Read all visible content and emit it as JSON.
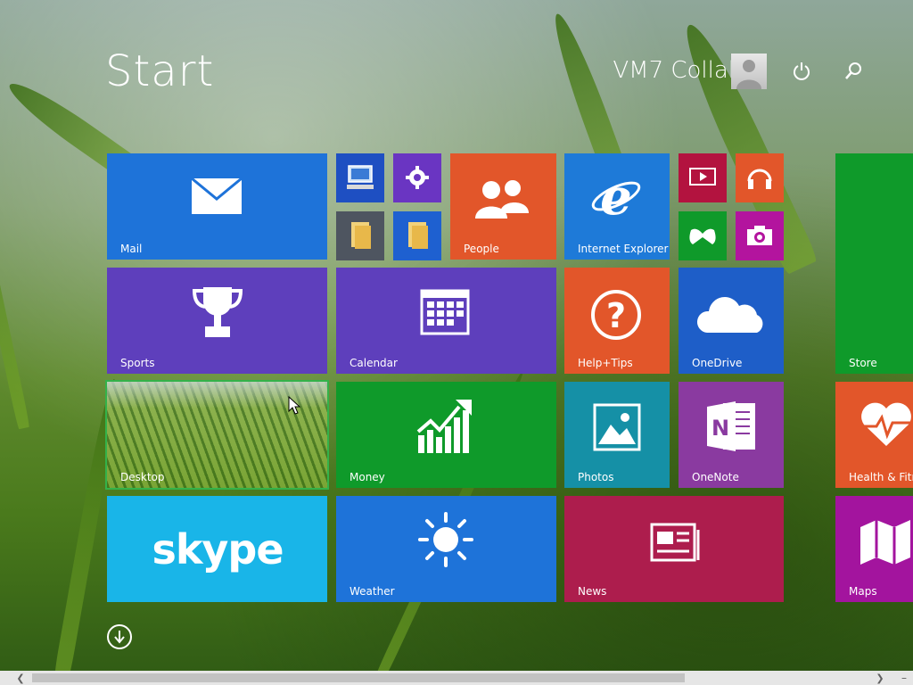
{
  "header": {
    "title": "Start",
    "user_name": "VM7 Collaber"
  },
  "icons": {
    "power": "power-icon",
    "search": "search-icon",
    "down": "arrow-down-icon"
  },
  "tiles": {
    "mail": "Mail",
    "people": "People",
    "internet_explorer": "Internet Explorer",
    "sports": "Sports",
    "calendar": "Calendar",
    "help_tips": "Help+Tips",
    "onedrive": "OneDrive",
    "store": "Store",
    "desktop": "Desktop",
    "money": "Money",
    "photos": "Photos",
    "onenote": "OneNote",
    "health": "Health & Fitne",
    "skype": "skype",
    "weather": "Weather",
    "news": "News",
    "maps": "Maps"
  },
  "colors": {
    "mail": "#1e73d9",
    "people": "#e2562a",
    "ie": "#1e7ad8",
    "sports": "#5e3fbc",
    "calendar": "#5e3fbc",
    "help": "#e2562a",
    "onedrive": "#1e5ec8",
    "store": "#0f9a2a",
    "money": "#0f9a2a",
    "photos": "#1590a6",
    "onenote": "#8a3aa0",
    "health": "#e2562a",
    "skype": "#19b5e8",
    "weather": "#1e73d9",
    "news": "#ad1d4d",
    "maps": "#a3149e",
    "selection": "#34b24a"
  }
}
